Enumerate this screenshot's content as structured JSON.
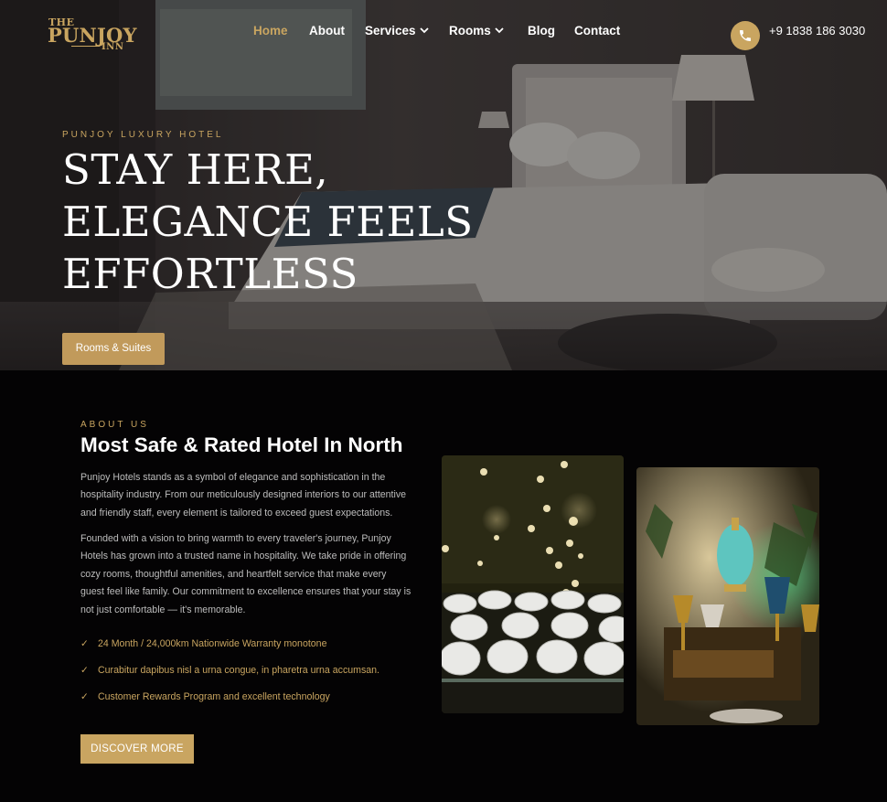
{
  "brand": {
    "line1": "THE",
    "line2": "PUNJOY",
    "line3": "INN"
  },
  "nav": [
    {
      "label": "Home",
      "active": true
    },
    {
      "label": "About"
    },
    {
      "label": "Services",
      "dropdown": true
    },
    {
      "label": "Rooms",
      "dropdown": true
    },
    {
      "label": "Blog"
    },
    {
      "label": "Contact"
    }
  ],
  "phone": "+9 1838 186 3030",
  "hero": {
    "eyebrow": "PUNJOY LUXURY HOTEL",
    "title_lines": [
      "STAY HERE,",
      "ELEGANCE FEELS",
      "EFFORTLESS"
    ],
    "cta": "Rooms & Suites"
  },
  "about": {
    "eyebrow": "ABOUT US",
    "title": "Most Safe & Rated Hotel In North",
    "para1": [
      "Punjoy Hotels stands as a symbol of elegance and sophistication in the",
      "hospitality industry. From our meticulously designed interiors to our attentive",
      "and friendly staff, every element is tailored to exceed guest expectations."
    ],
    "para2": [
      "Founded with a vision to bring warmth to every traveler's journey, Punjoy",
      "Hotels has grown into a trusted name in hospitality. We take pride in offering",
      "cozy rooms, thoughtful amenities, and heartfelt service that make every",
      "guest feel like family. Our commitment to excellence ensures that your stay is",
      "not just comfortable — it's memorable."
    ],
    "features": [
      "24 Month / 24,000km Nationwide Warranty monotone",
      "Curabitur dapibus nisl a urna congue, in pharetra urna accumsan.",
      "Customer Rewards Program and excellent technology"
    ],
    "check_glyph": "✓",
    "cta": "DISCOVER MORE"
  },
  "colors": {
    "accent": "#c9a560",
    "background": "#040304"
  },
  "icons": {
    "phone": "phone-icon",
    "dropdown": "chevron-down-icon",
    "check": "check-icon"
  }
}
